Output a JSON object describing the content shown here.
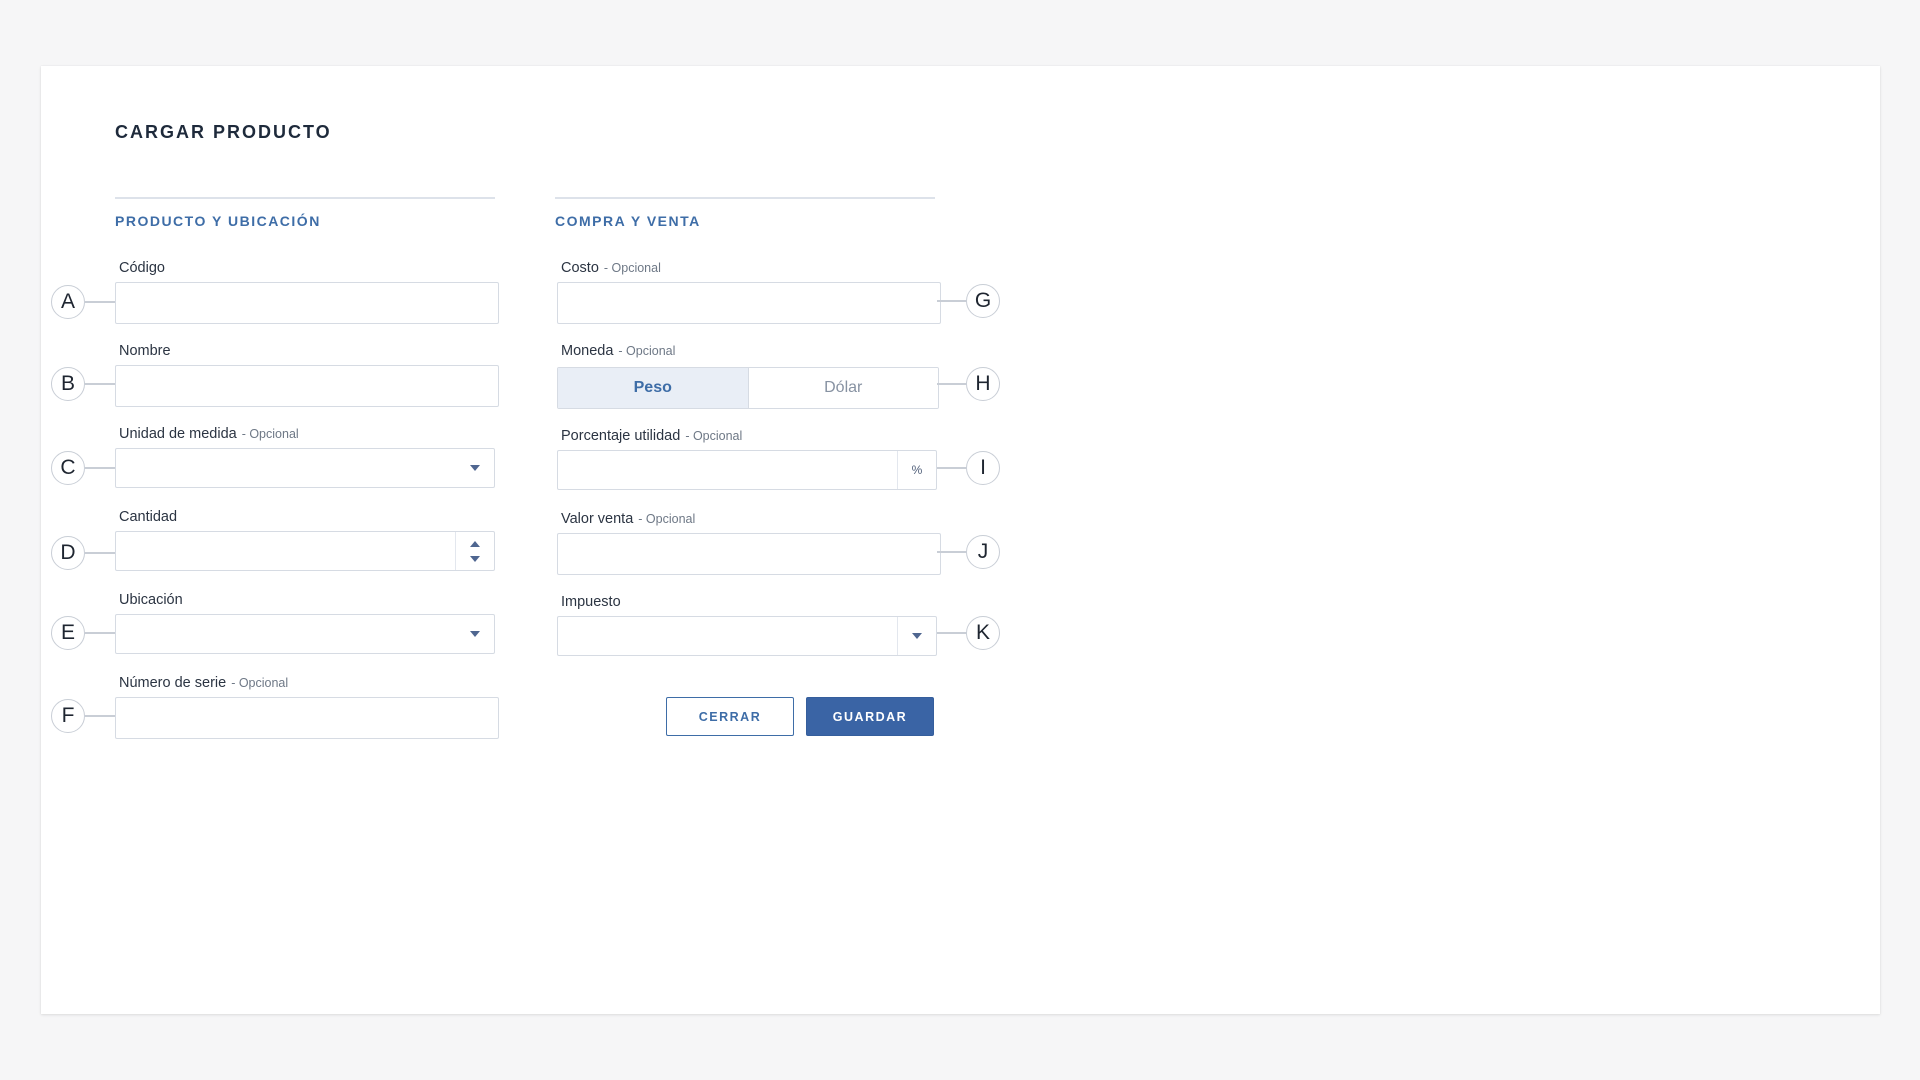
{
  "form": {
    "title": "CARGAR PRODUCTO",
    "sections": {
      "left_title": "PRODUCTO Y UBICACIÓN",
      "right_title": "COMPRA Y VENTA"
    },
    "optional_tag": "- Opcional",
    "fields": {
      "codigo": {
        "label": "Código",
        "callout": "A",
        "value": ""
      },
      "nombre": {
        "label": "Nombre",
        "callout": "B",
        "value": ""
      },
      "unidad": {
        "label": "Unidad de medida",
        "callout": "C",
        "value": ""
      },
      "cantidad": {
        "label": "Cantidad",
        "callout": "D",
        "value": ""
      },
      "ubicacion": {
        "label": "Ubicación",
        "callout": "E",
        "value": ""
      },
      "serie": {
        "label": "Número de serie",
        "callout": "F",
        "value": ""
      },
      "costo": {
        "label": "Costo",
        "callout": "G",
        "value": ""
      },
      "moneda": {
        "label": "Moneda",
        "callout": "H",
        "options": [
          "Peso",
          "Dólar"
        ],
        "selected": "Peso"
      },
      "porcentaje": {
        "label": "Porcentaje utilidad",
        "callout": "I",
        "suffix": "%",
        "value": ""
      },
      "valor_venta": {
        "label": "Valor venta",
        "callout": "J",
        "value": ""
      },
      "impuesto": {
        "label": "Impuesto",
        "callout": "K",
        "value": ""
      }
    },
    "buttons": {
      "close": "CERRAR",
      "save": "GUARDAR"
    }
  },
  "colors": {
    "accent": "#3e6da7",
    "primary_button": "#3a64a5",
    "active_segment_bg": "#e9eef6"
  }
}
